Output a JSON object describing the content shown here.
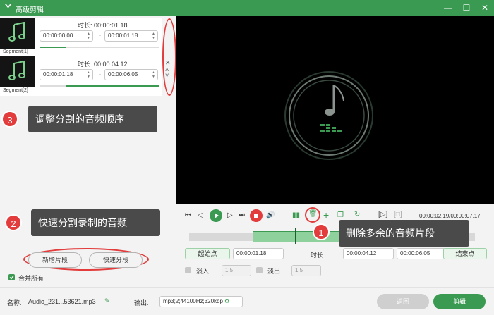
{
  "window": {
    "title": "高级剪辑",
    "minimize": "—",
    "maximize": "☐",
    "close": "✕"
  },
  "segments": [
    {
      "label": "Segment[1]",
      "duration_label": "时长: 00:00:01.18",
      "start": "00:00:00.00",
      "end": "00:00:01.18",
      "progress": 0.22
    },
    {
      "label": "Segment[2]",
      "duration_label": "时长: 00:00:04.12",
      "start": "00:00:01.18",
      "end": "00:00:06.05",
      "progress_start": 0.22,
      "progress_end": 1.0
    }
  ],
  "segment_controls": {
    "delete": "✕",
    "up": "˄",
    "down": "˅"
  },
  "callouts": [
    {
      "number": "3",
      "text": "调整分割的音频顺序"
    },
    {
      "number": "2",
      "text": "快速分割录制的音频"
    },
    {
      "number": "1",
      "text": "删除多余的音频片段"
    }
  ],
  "left_buttons": {
    "new_segment": "新增片段",
    "quick_split": "快速分段"
  },
  "merge_all": {
    "label": "合并所有",
    "checked": true
  },
  "playback": {
    "time": "00:00:02.19/00:00:07.17"
  },
  "range": {
    "start_button": "起始点",
    "start_value": "00:00:01.18",
    "duration_label": "时长:",
    "duration_value": "00:00:04.12",
    "end_value": "00:00:06.05",
    "end_button": "结束点"
  },
  "fade": {
    "fade_in_label": "淡入",
    "fade_in_value": "1.5",
    "fade_out_label": "淡出",
    "fade_out_value": "1.5"
  },
  "footer": {
    "name_label": "名称:",
    "name_value": "Audio_231...53621.mp3",
    "output_label": "输出:",
    "output_value": "mp3;2;44100Hz;320kbp",
    "back_button": "返回",
    "cut_button": "剪辑"
  },
  "colors": {
    "brand_green": "#3a9a52",
    "callout_red": "#e23c3c",
    "tooltip_bg": "#4a4a4a"
  }
}
